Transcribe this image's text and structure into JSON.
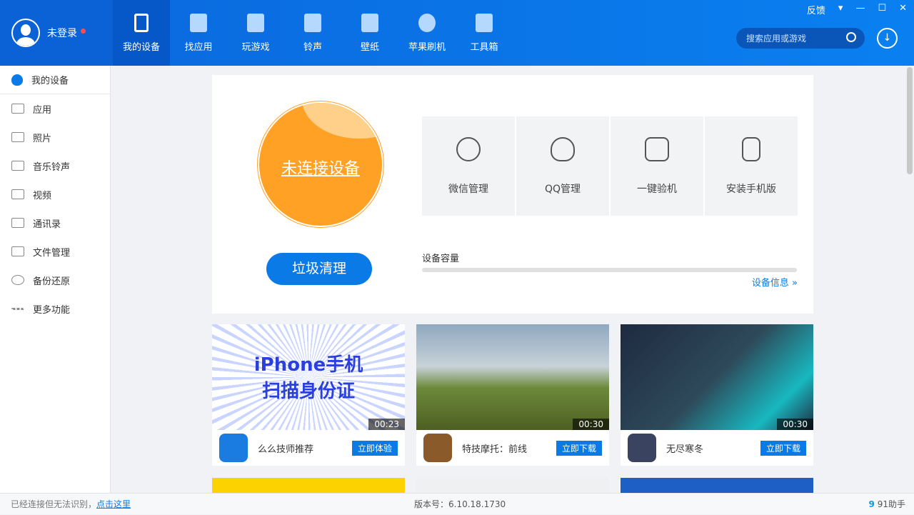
{
  "user": {
    "label": "未登录"
  },
  "nav": [
    {
      "label": "我的设备",
      "icon": "phone-icon"
    },
    {
      "label": "找应用",
      "icon": "bag-icon"
    },
    {
      "label": "玩游戏",
      "icon": "gamepad-icon"
    },
    {
      "label": "铃声",
      "icon": "music-icon"
    },
    {
      "label": "壁纸",
      "icon": "image-icon"
    },
    {
      "label": "苹果刷机",
      "icon": "refresh-icon"
    },
    {
      "label": "工具箱",
      "icon": "toolbox-icon"
    }
  ],
  "window": {
    "feedback": "反馈",
    "menu": "▾",
    "minimize": "—",
    "maximize": "☐",
    "close": "✕"
  },
  "search": {
    "placeholder": "搜索应用或游戏"
  },
  "sidebar": [
    {
      "label": "我的设备"
    },
    {
      "label": "应用"
    },
    {
      "label": "照片"
    },
    {
      "label": "音乐铃声"
    },
    {
      "label": "视频"
    },
    {
      "label": "通讯录"
    },
    {
      "label": "文件管理"
    },
    {
      "label": "备份还原"
    },
    {
      "label": "更多功能"
    }
  ],
  "device": {
    "status": "未连接设备",
    "clean": "垃圾清理",
    "capacity_label": "设备容量",
    "capacity_used": 0,
    "info_link": "设备信息 »"
  },
  "tools": [
    {
      "label": "微信管理"
    },
    {
      "label": "QQ管理"
    },
    {
      "label": "一键验机"
    },
    {
      "label": "安装手机版"
    }
  ],
  "tiles": [
    {
      "name": "么么技师推荐",
      "button": "立即体验",
      "duration": "00:23",
      "banner1": "iPhone手机",
      "banner2": "扫描身份证"
    },
    {
      "name": "特技摩托：前线",
      "button": "立即下载",
      "duration": "00:30"
    },
    {
      "name": "无尽寒冬",
      "button": "立即下载",
      "duration": "00:30"
    }
  ],
  "status": {
    "text": "已经连接但无法识别，",
    "link": "点击这里",
    "version": "版本号：6.10.18.1730",
    "brand": "91助手"
  }
}
